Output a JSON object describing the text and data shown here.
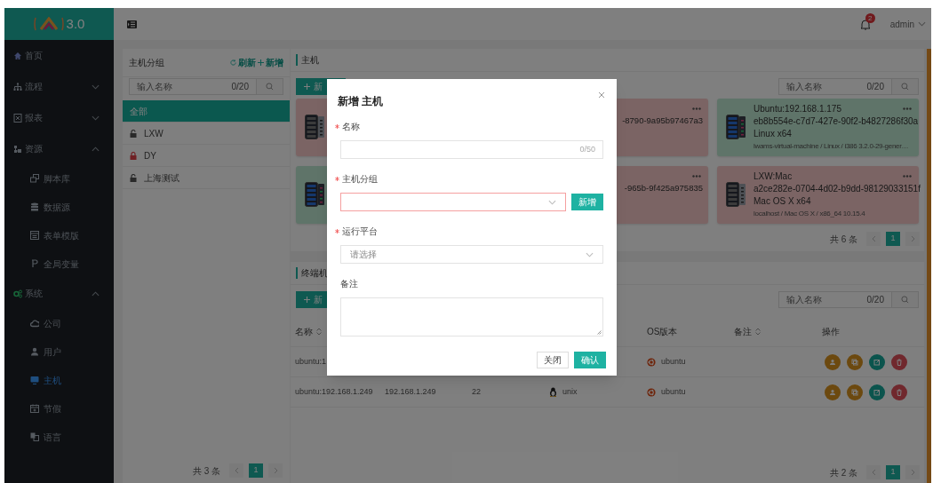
{
  "logo": {
    "text": "3.0"
  },
  "sidebar": {
    "items": [
      {
        "label": "首页",
        "selected": false
      },
      {
        "label": "流程",
        "expanded": false,
        "selected": false
      },
      {
        "label": "报表",
        "expanded": false,
        "selected": false
      },
      {
        "label": "资源",
        "expanded": true,
        "selected": false,
        "children": [
          {
            "label": "脚本库",
            "selected": false
          },
          {
            "label": "数据源",
            "selected": false
          },
          {
            "label": "表单模版",
            "selected": false
          },
          {
            "label": "全局变量",
            "selected": false
          }
        ]
      },
      {
        "label": "系统",
        "expanded": true,
        "selected": false,
        "children": [
          {
            "label": "公司",
            "selected": false
          },
          {
            "label": "用户",
            "selected": false
          },
          {
            "label": "主机",
            "selected": true
          },
          {
            "label": "节假",
            "selected": false
          },
          {
            "label": "语言",
            "selected": false
          }
        ]
      }
    ]
  },
  "header": {
    "notifications": "2",
    "user": "admin"
  },
  "groups": {
    "title": "主机分组",
    "actions": [
      {
        "kind": "refresh",
        "label": "刷新"
      },
      {
        "kind": "add",
        "label": "新增"
      }
    ],
    "search": {
      "placeholder": "输入名称",
      "counter": "0/20"
    },
    "items": [
      {
        "label": "全部",
        "selected": true
      },
      {
        "label": "LXW",
        "locked": false,
        "selected": false
      },
      {
        "label": "DY",
        "locked": true,
        "selected": false
      },
      {
        "label": "上海测试",
        "locked": false,
        "selected": false
      }
    ],
    "pagination": {
      "total": "共 3 条",
      "pages": [
        {
          "label": "1",
          "selected": true
        }
      ]
    }
  },
  "hosts": {
    "title": "主机",
    "add_button": "新",
    "search": {
      "placeholder": "输入名称",
      "counter": "0/20"
    },
    "cards": [
      {
        "online": false
      },
      {
        "online": false,
        "uuid": "-8790-9a95b97467a3"
      },
      {
        "online": true,
        "title": "Ubuntu:192.168.1.175",
        "uuid": "eb8b554e-c7d7-427e-90f2-b4827286f30a",
        "os": "Linux x64",
        "detail": "lwams-virtual-machine / Linux / i386 3.2.0-29-gener…"
      },
      {
        "online": true
      },
      {
        "online": false,
        "uuid": "-965b-9f425a975835"
      },
      {
        "online": false,
        "title": "LXW:Mac",
        "uuid": "a2ce282e-0704-4d02-b9dd-98129033151f",
        "os": "Mac OS X x64",
        "detail": "localhost / Mac OS X / x86_64 10.15.4"
      }
    ],
    "pagination": {
      "total": "共 6 条",
      "pages": [
        {
          "label": "1",
          "selected": true
        }
      ]
    }
  },
  "terminals": {
    "title": "终端机",
    "add_button": "新",
    "search": {
      "placeholder": "输入名称",
      "counter": "0/20"
    },
    "table": {
      "columns": [
        {
          "label": "名称",
          "sortable": true
        },
        {},
        {},
        {},
        {
          "label": "OS版本",
          "sortable": false
        },
        {
          "label": "备注",
          "sortable": true
        },
        {
          "label": "操作",
          "sortable": false
        }
      ],
      "rows": [
        {
          "name": "ubuntu:1",
          "os": "ubuntu"
        },
        {
          "name": "ubuntu:192.168.1.249",
          "ip": "192.168.1.249",
          "port": "22",
          "platform": "unix",
          "os": "ubuntu"
        }
      ]
    },
    "pagination": {
      "total": "共 2 条",
      "pages": [
        {
          "label": "1",
          "selected": true
        }
      ]
    }
  },
  "dialog": {
    "title": "新增 主机",
    "fields": [
      {
        "kind": "text",
        "label": "名称",
        "required": true,
        "counter": "0/50"
      },
      {
        "kind": "select",
        "label": "主机分组",
        "required": true,
        "invalid": true,
        "button": "新增"
      },
      {
        "kind": "select",
        "label": "运行平台",
        "required": true,
        "invalid": false,
        "placeholder": "请选择"
      },
      {
        "kind": "textarea",
        "label": "备注",
        "required": false
      }
    ],
    "buttons": [
      {
        "label": "关闭",
        "primary": false
      },
      {
        "label": "确认",
        "primary": true
      }
    ]
  }
}
